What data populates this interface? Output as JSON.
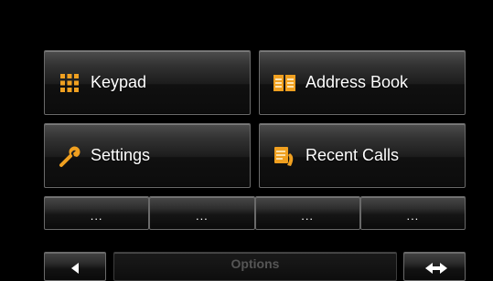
{
  "main_menu": {
    "keypad": {
      "label": "Keypad",
      "icon": "keypad-icon"
    },
    "address_book": {
      "label": "Address Book",
      "icon": "address-book-icon"
    },
    "settings": {
      "label": "Settings",
      "icon": "wrench-icon"
    },
    "recent_calls": {
      "label": "Recent Calls",
      "icon": "recent-calls-icon"
    }
  },
  "quick_buttons": [
    "...",
    "...",
    "...",
    "..."
  ],
  "bottom_bar": {
    "back_icon": "left-arrow-icon",
    "options_label": "Options",
    "expand_icon": "left-right-arrows-icon"
  },
  "colors": {
    "background": "#000000",
    "icon_accent": "#f0a020",
    "button_border": "#6a6a6a",
    "disabled_text": "#555555"
  }
}
